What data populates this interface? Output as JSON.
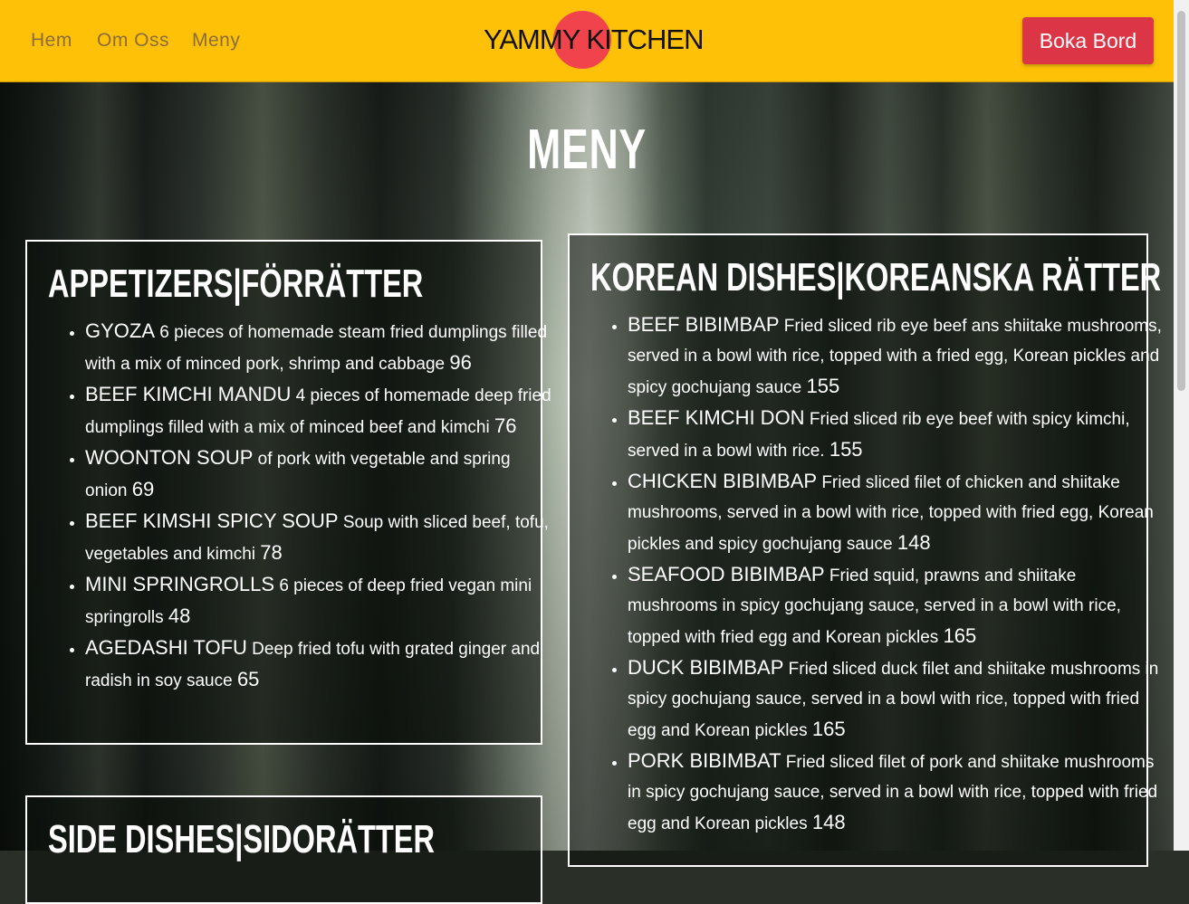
{
  "nav": {
    "links": [
      "Hem",
      "Om Oss",
      "Meny"
    ],
    "logo": "YAMMY KITCHEN",
    "cta": "Boka Bord"
  },
  "colors": {
    "header": "#ffc107",
    "button": "#dc3545",
    "logo_circle": "#f0434b"
  },
  "page": {
    "title": "MENY"
  },
  "sections": {
    "appetizers": {
      "title": "APPETIZERS|FÖRRÄTTER",
      "items": [
        {
          "name": "GYOZA",
          "desc": "6 pieces of homemade steam fried dumplings filled with a mix of minced pork, shrimp and cabbage",
          "price": "96"
        },
        {
          "name": "BEEF KIMCHI MANDU",
          "desc": "4 pieces of homemade deep fried dumplings filled with a mix of minced beef and kimchi",
          "price": "76"
        },
        {
          "name": "WOONTON SOUP",
          "desc": "of pork with vegetable and spring onion",
          "price": "69"
        },
        {
          "name": "BEEF KIMSHI SPICY SOUP",
          "desc": "Soup with sliced beef, tofu, vegetables and kimchi",
          "price": "78"
        },
        {
          "name": "MINI SPRINGROLLS",
          "desc": "6 pieces of deep fried vegan mini springrolls",
          "price": "48"
        },
        {
          "name": "AGEDASHI TOFU",
          "desc": "Deep fried tofu with grated ginger and radish in soy sauce",
          "price": "65"
        }
      ]
    },
    "korean": {
      "title": "KOREAN DISHES|KOREANSKA RÄTTER",
      "items": [
        {
          "name": "BEEF BIBIMBAP",
          "desc": "Fried sliced rib eye beef ans shiitake mushrooms, served in a bowl with rice, topped with a fried egg, Korean pickles and spicy gochujang sauce",
          "price": "155"
        },
        {
          "name": "BEEF KIMCHI DON",
          "desc": "Fried sliced rib eye beef with spicy kimchi, served in a bowl with rice.",
          "price": "155"
        },
        {
          "name": "CHICKEN BIBIMBAP",
          "desc": "Fried sliced filet of chicken and shiitake mushrooms, served in a bowl with rice, topped with fried egg, Korean pickles and spicy gochujang sauce",
          "price": "148"
        },
        {
          "name": "SEAFOOD BIBIMBAP",
          "desc": "Fried squid, prawns and shiitake mushrooms in spicy gochujang sauce, served in a bowl with rice, topped with fried egg and Korean pickles",
          "price": "165"
        },
        {
          "name": "DUCK BIBIMBAP",
          "desc": "Fried sliced duck filet and shiitake mushrooms in spicy gochujang sauce, served in a bowl with rice, topped with fried egg and Korean pickles",
          "price": "165"
        },
        {
          "name": "PORK BIBIMBAT",
          "desc": "Fried sliced filet of pork and shiitake mushrooms in spicy gochujang sauce, served in a bowl with rice, topped with fried egg and Korean pickles",
          "price": "148"
        }
      ]
    },
    "sides": {
      "title": "SIDE DISHES|SIDORÄTTER"
    }
  }
}
